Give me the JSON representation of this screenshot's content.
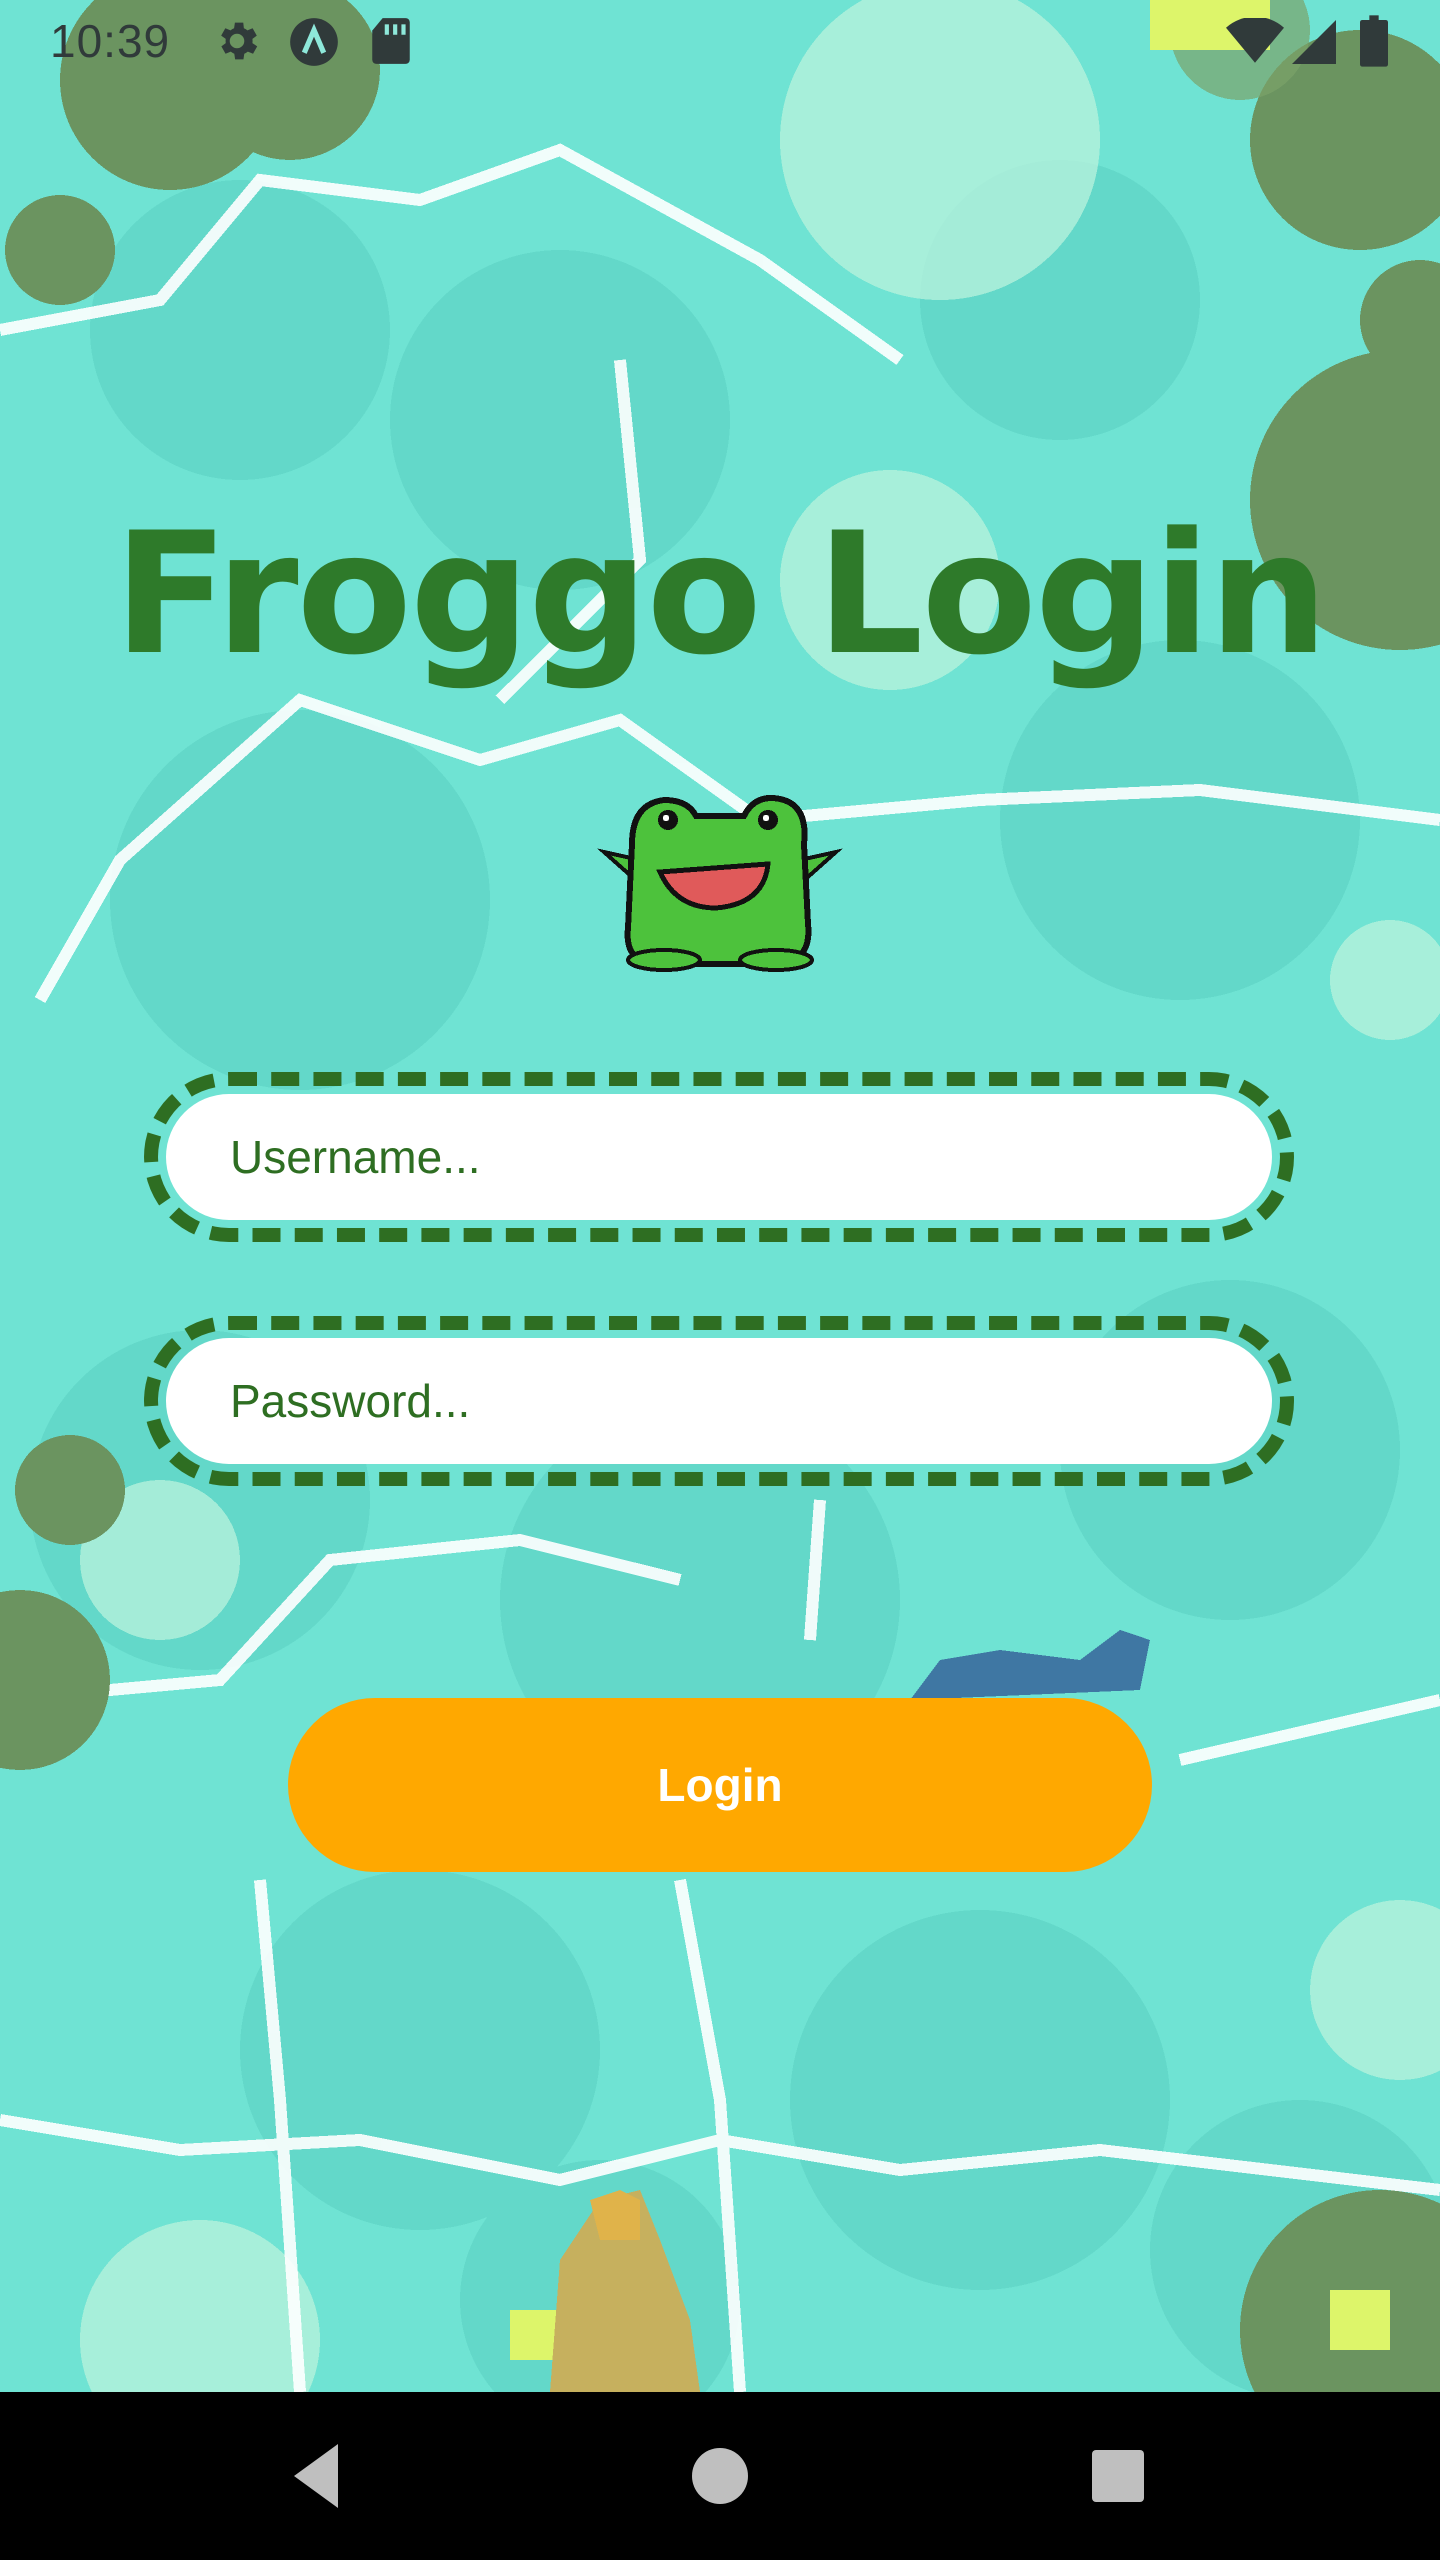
{
  "status_bar": {
    "time": "10:39",
    "icons": [
      "settings-icon",
      "arch-icon",
      "sd-card-icon",
      "wifi-icon",
      "cell-signal-icon",
      "battery-icon"
    ]
  },
  "title": "Froggo Login",
  "mascot": "frog-icon",
  "form": {
    "username_placeholder": "Username...",
    "password_placeholder": "Password...",
    "login_label": "Login"
  },
  "colors": {
    "title": "#2e7a2a",
    "field_border": "#2e6e22",
    "button": "#ffa800",
    "water": "#6fe3d3"
  },
  "nav_bar": {
    "buttons": [
      "back-icon",
      "home-icon",
      "recents-icon"
    ]
  }
}
